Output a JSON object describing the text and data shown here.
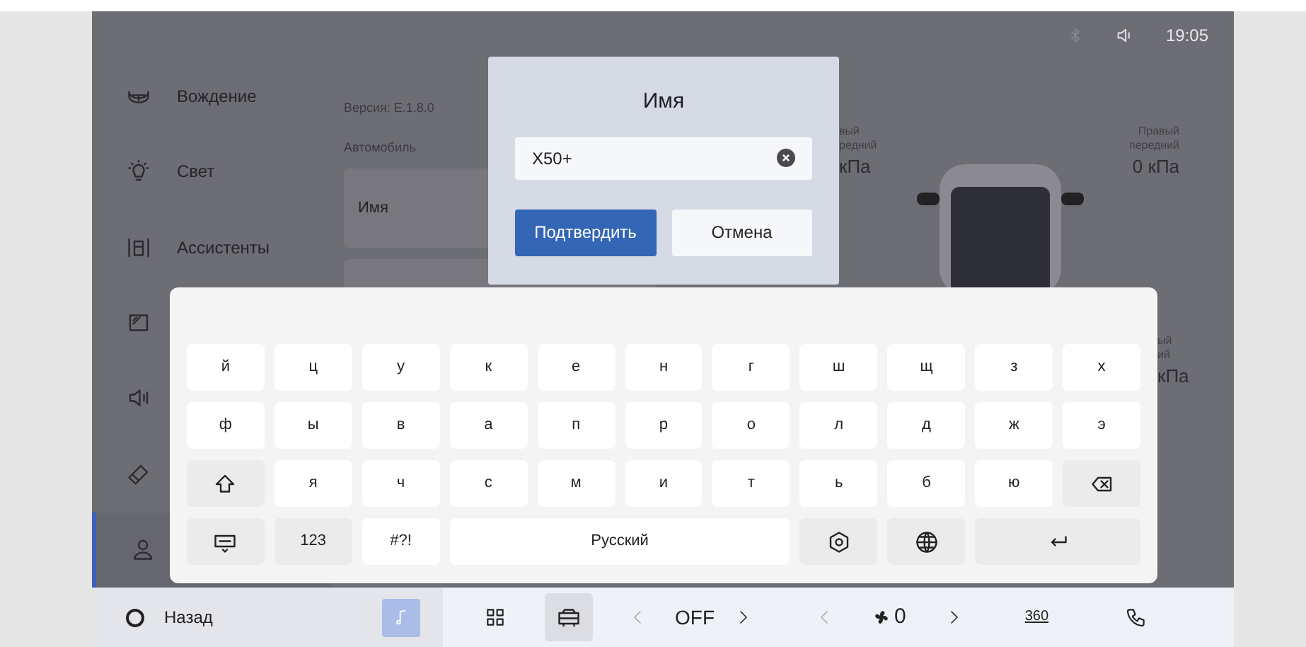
{
  "status_bar": {
    "time": "19:05"
  },
  "sidebar": {
    "items": [
      {
        "label": "Вождение",
        "selected": false
      },
      {
        "label": "Свет",
        "selected": false
      },
      {
        "label": "Ассистенты",
        "selected": false
      },
      {
        "selected": false
      },
      {
        "selected": false
      },
      {
        "selected": false
      },
      {
        "selected": true
      }
    ]
  },
  "settings": {
    "version": "Версия: E.1.8.0",
    "section": "Автомобиль",
    "name_label": "Имя"
  },
  "tires": [
    {
      "label_lines": [
        "вый",
        "редний"
      ],
      "value": "кПа"
    },
    {
      "label_lines": [
        "Правый",
        "передний"
      ],
      "value": "0 кПа"
    },
    {
      "label_lines": [
        "ый",
        "ий"
      ],
      "value": "кПа"
    }
  ],
  "dialog": {
    "title": "Имя",
    "input": {
      "value": "X50+"
    },
    "buttons": [
      {
        "label": "Подтвердить",
        "primary": true
      },
      {
        "label": "Отмена",
        "primary": false
      }
    ]
  },
  "keyboard": {
    "rows": [
      [
        {
          "kind": "char",
          "label": "й"
        },
        {
          "kind": "char",
          "label": "ц"
        },
        {
          "kind": "char",
          "label": "у"
        },
        {
          "kind": "char",
          "label": "к"
        },
        {
          "kind": "char",
          "label": "е"
        },
        {
          "kind": "char",
          "label": "н"
        },
        {
          "kind": "char",
          "label": "г"
        },
        {
          "kind": "char",
          "label": "ш"
        },
        {
          "kind": "char",
          "label": "щ"
        },
        {
          "kind": "char",
          "label": "з"
        },
        {
          "kind": "char",
          "label": "х"
        }
      ],
      [
        {
          "kind": "char",
          "label": "ф"
        },
        {
          "kind": "char",
          "label": "ы"
        },
        {
          "kind": "char",
          "label": "в"
        },
        {
          "kind": "char",
          "label": "а"
        },
        {
          "kind": "char",
          "label": "п"
        },
        {
          "kind": "char",
          "label": "р"
        },
        {
          "kind": "char",
          "label": "о"
        },
        {
          "kind": "char",
          "label": "л"
        },
        {
          "kind": "char",
          "label": "д"
        },
        {
          "kind": "char",
          "label": "ж"
        },
        {
          "kind": "char",
          "label": "э"
        }
      ],
      [
        {
          "kind": "shift"
        },
        {
          "kind": "char",
          "label": "я"
        },
        {
          "kind": "char",
          "label": "ч"
        },
        {
          "kind": "char",
          "label": "с"
        },
        {
          "kind": "char",
          "label": "м"
        },
        {
          "kind": "char",
          "label": "и"
        },
        {
          "kind": "char",
          "label": "т"
        },
        {
          "kind": "char",
          "label": "ь"
        },
        {
          "kind": "char",
          "label": "б"
        },
        {
          "kind": "char",
          "label": "ю"
        },
        {
          "kind": "backspace"
        }
      ],
      [
        {
          "kind": "hide"
        },
        {
          "kind": "mode",
          "label": "123"
        },
        {
          "kind": "char",
          "label": "#?!"
        },
        {
          "kind": "space",
          "label": "Русский"
        },
        {
          "kind": "hex"
        },
        {
          "kind": "globe"
        },
        {
          "kind": "enter"
        }
      ]
    ]
  },
  "bottom_bar": {
    "back": "Назад",
    "nav": [
      {
        "kind": "music",
        "selected": false
      },
      {
        "kind": "apps",
        "selected": false
      },
      {
        "kind": "car",
        "selected": true
      }
    ],
    "ac": "OFF",
    "fan": "0",
    "camera": "360"
  }
}
